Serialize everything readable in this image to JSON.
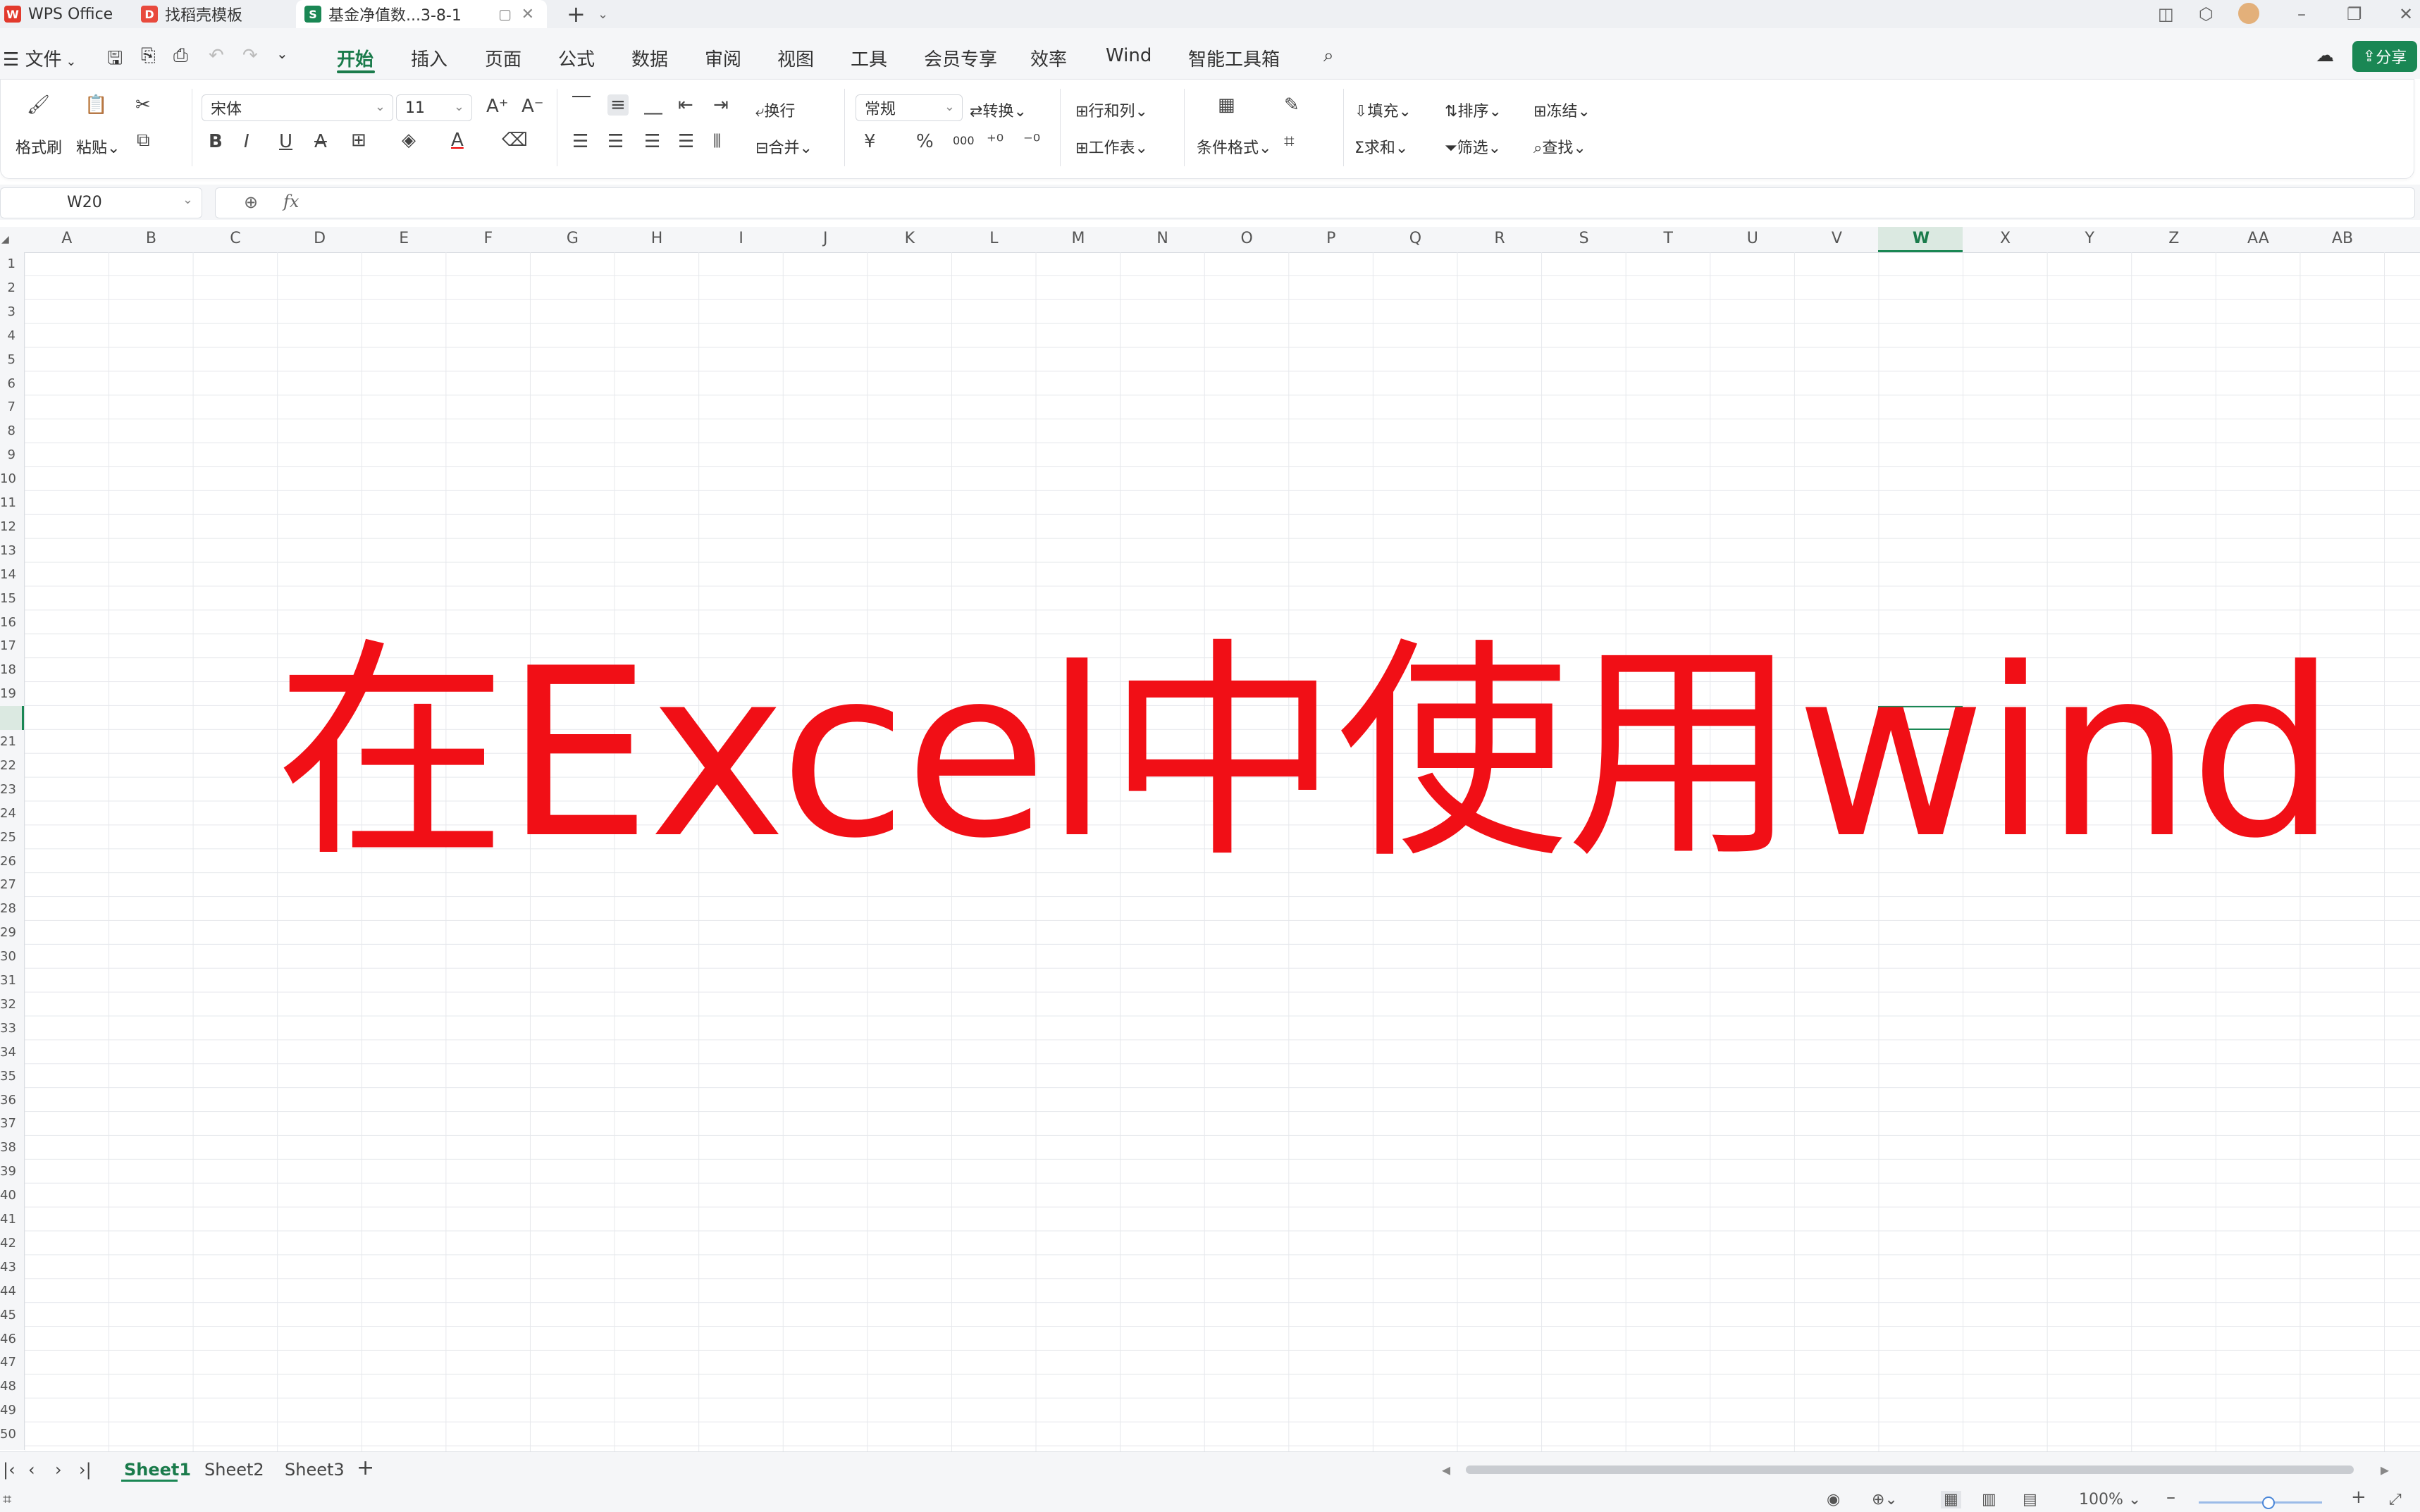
{
  "tabs": [
    {
      "label": "WPS Office",
      "icon": "wps-logo-icon",
      "color": "#e23a2d"
    },
    {
      "label": "找稻壳模板",
      "icon": "docer-icon",
      "color": "#e84a3d"
    },
    {
      "label": "基金净值数...3-8-1",
      "icon": "spreadsheet-s-icon",
      "color": "#1a8754"
    }
  ],
  "menu": {
    "file": "文件",
    "items": [
      "开始",
      "插入",
      "页面",
      "公式",
      "数据",
      "审阅",
      "视图",
      "工具",
      "会员专享",
      "效率",
      "Wind",
      "智能工具箱"
    ],
    "share": "分享"
  },
  "ribbon": {
    "format_painter": "格式刷",
    "paste": "粘贴",
    "font_name": "宋体",
    "font_size": "11",
    "wrap": "换行",
    "merge": "合并",
    "number_format": "常规",
    "convert": "转换",
    "row_col": "行和列",
    "worksheet": "工作表",
    "cond_format": "条件格式",
    "fill": "填充",
    "sort": "排序",
    "freeze": "冻结",
    "sum": "求和",
    "filter": "筛选",
    "find": "查找",
    "currency": "¥",
    "percent": "%",
    "thousands": "000"
  },
  "formula_bar": {
    "name_box": "W20",
    "fx": "fx",
    "value": ""
  },
  "columns": [
    "A",
    "B",
    "C",
    "D",
    "E",
    "F",
    "G",
    "H",
    "I",
    "J",
    "K",
    "L",
    "M",
    "N",
    "O",
    "P",
    "Q",
    "R",
    "S",
    "T",
    "U",
    "V",
    "W",
    "X",
    "Y",
    "Z",
    "AA",
    "AB"
  ],
  "selected_cell": {
    "column": "W",
    "row": "20"
  },
  "overlay_title": "在Excel中使用wind",
  "sheets": [
    "Sheet1",
    "Sheet2",
    "Sheet3"
  ],
  "active_sheet": "Sheet1",
  "status": {
    "zoom": "100%"
  },
  "colors": {
    "accent": "#1a8754",
    "overlay": "#f10f16"
  }
}
